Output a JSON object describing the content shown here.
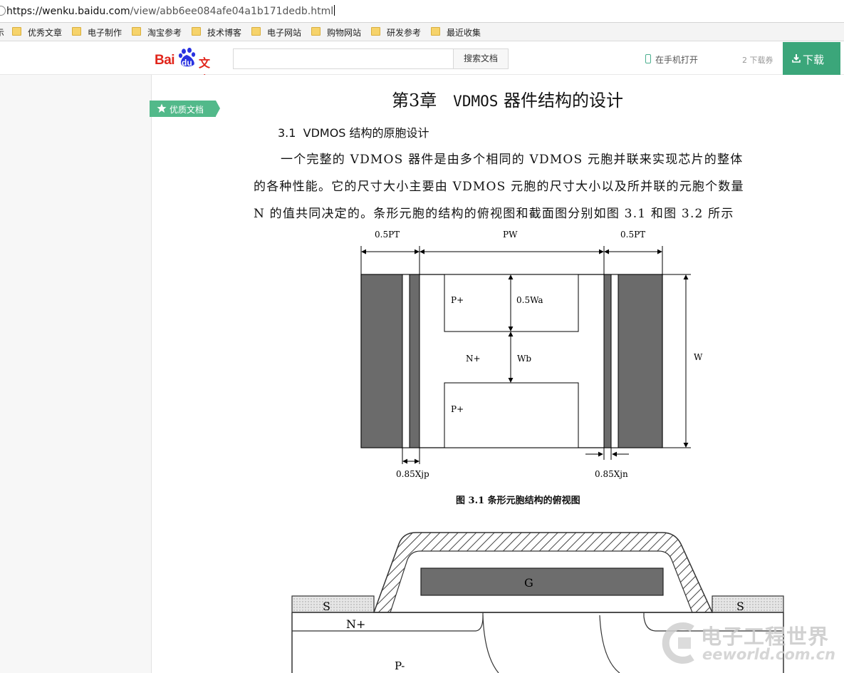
{
  "browser": {
    "url_host": "https://wenku.baidu.com",
    "url_path": "/view/abb6ee084afe04a1b171dedb.html",
    "bookmarks": [
      {
        "label": "优秀文章"
      },
      {
        "label": "电子制作"
      },
      {
        "label": "淘宝参考"
      },
      {
        "label": "技术博客"
      },
      {
        "label": "电子网站"
      },
      {
        "label": "购物网站"
      },
      {
        "label": "研发参考"
      },
      {
        "label": "最近收集"
      }
    ],
    "bookmark_edge_char": "示"
  },
  "header": {
    "logo_bai": "Bai",
    "logo_du": "du",
    "logo_wenku": "文库",
    "search_value": "",
    "search_button": "搜索文档",
    "mobile_open": "在手机打开",
    "coupon": "2 下载券",
    "download": "下载"
  },
  "doc": {
    "badge": "优质文档",
    "chapter_prefix": "第3章",
    "chapter_name_mono": "VDMOS",
    "chapter_name_rest": "器件结构的设计",
    "section_num": "3.1",
    "section_mono": "VDMOS",
    "section_rest": "结构的原胞设计",
    "para_line1": "一个完整的 VDMOS 器件是由多个相同的 VDMOS 元胞并联来实现芯片的整体",
    "para_line2": "的各种性能。它的尺寸大小主要由 VDMOS 元胞的尺寸大小以及所并联的元胞个数量",
    "para_line3": "N 的值共同决定的。条形元胞的结构的俯视图和截面图分别如图 3.1 和图 3.2 所示",
    "fig1": {
      "label_half_pt_left": "0.5PT",
      "label_pw": "PW",
      "label_half_pt_right": "0.5PT",
      "label_p_top": "P+",
      "label_half_wa": "0.5Wa",
      "label_n_plus": "N+",
      "label_wb": "Wb",
      "label_p_bottom": "P+",
      "label_w": "W",
      "label_xjp": "0.85Xjp",
      "label_xjn": "0.85Xjn",
      "caption": "图 3.1  条形元胞结构的俯视图"
    },
    "fig2": {
      "label_g": "G",
      "label_s_left": "S",
      "label_s_right": "S",
      "label_n_plus": "N+",
      "label_p_minus": "P-"
    }
  },
  "watermark": {
    "cn": "电子工程世界",
    "en": "eeworld.com.cn"
  },
  "colors": {
    "download_green": "#3ba67a",
    "badge_green": "#52b98a",
    "baidu_red": "#e1251b",
    "baidu_blue": "#2932e1"
  }
}
